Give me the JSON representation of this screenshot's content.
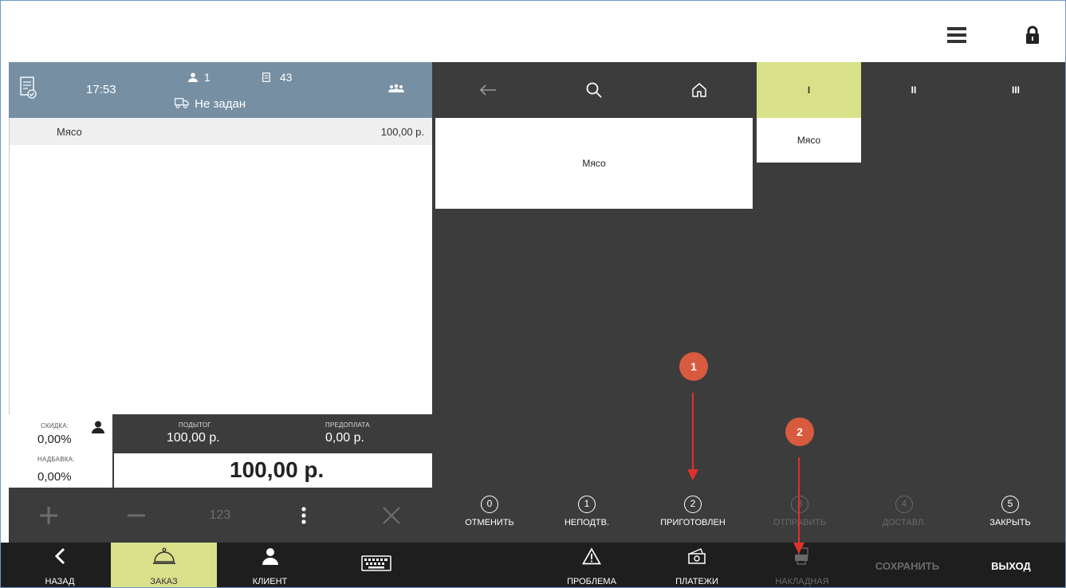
{
  "order": {
    "time": "17:53",
    "guests": "1",
    "cheque_no": "43",
    "delivery": "Не задан",
    "items": [
      {
        "name": "Мясо",
        "price": "100,00 р."
      }
    ]
  },
  "totals": {
    "discount_label": "СКИДКА:",
    "discount": "0,00%",
    "markup_label": "НАДБАВКА:",
    "markup": "0,00%",
    "subtotal_label": "ПОДЫТОГ",
    "subtotal": "100,00 р.",
    "prepay_label": "ПРЕДОПЛАТА",
    "prepay": "0,00 р.",
    "total": "100,00 р."
  },
  "left_tools": {
    "keypad": "123"
  },
  "tabs": [
    "I",
    "II",
    "III"
  ],
  "tiles": {
    "category": "Мясо",
    "product": "Мясо"
  },
  "statuses": [
    {
      "num": "0",
      "label": "ОТМЕНИТЬ"
    },
    {
      "num": "1",
      "label": "НЕПОДТВ."
    },
    {
      "num": "2",
      "label": "ПРИГОТОВЛЕН"
    },
    {
      "num": "3",
      "label": "ОТПРАВИТЬ"
    },
    {
      "num": "4",
      "label": "ДОСТАВЛ."
    },
    {
      "num": "5",
      "label": "ЗАКРЫТЬ"
    }
  ],
  "bottom": {
    "back": "НАЗАД",
    "order": "ЗАКАЗ",
    "client": "КЛИЕНТ",
    "problem": "ПРОБЛЕМА",
    "payments": "ПЛАТЕЖИ",
    "invoice": "НАКЛАДНАЯ",
    "save": "СОХРАНИТЬ",
    "exit": "ВЫХОД"
  },
  "annotations": [
    "1",
    "2"
  ],
  "colors": {
    "accent": "#d9e08a",
    "header": "#768fa3",
    "panel": "#3c3c3c",
    "badge": "#d85a3f",
    "arrow": "#e0302b"
  }
}
